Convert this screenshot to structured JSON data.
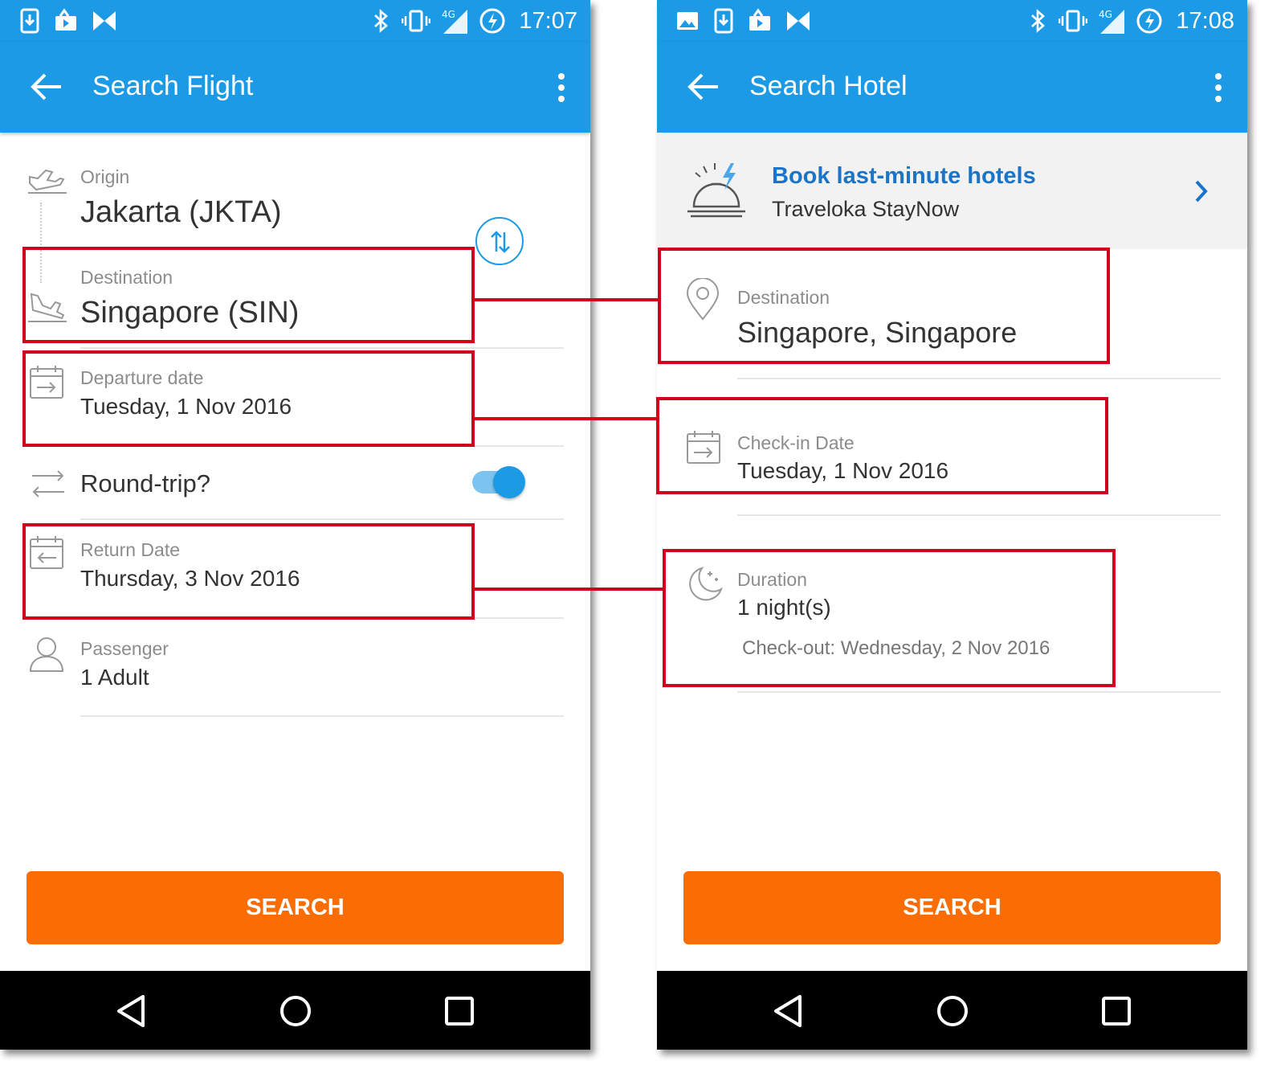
{
  "left_screen": {
    "status": {
      "time": "17:07",
      "network": "4G"
    },
    "appbar": {
      "title": "Search Flight"
    },
    "origin": {
      "label": "Origin",
      "value": "Jakarta (JKTA)"
    },
    "destination": {
      "label": "Destination",
      "value": "Singapore (SIN)"
    },
    "departure": {
      "label": "Departure date",
      "value": "Tuesday, 1 Nov 2016"
    },
    "roundtrip": {
      "label": "Round-trip?",
      "enabled": true
    },
    "return_date": {
      "label": "Return Date",
      "value": "Thursday, 3 Nov 2016"
    },
    "passenger": {
      "label": "Passenger",
      "value": "1 Adult"
    },
    "search_label": "SEARCH"
  },
  "right_screen": {
    "status": {
      "time": "17:08",
      "network": "4G"
    },
    "appbar": {
      "title": "Search Hotel"
    },
    "promo": {
      "title": "Book last-minute hotels",
      "subtitle": "Traveloka StayNow"
    },
    "destination": {
      "label": "Destination",
      "value": "Singapore, Singapore"
    },
    "checkin": {
      "label": "Check-in Date",
      "value": "Tuesday, 1 Nov 2016"
    },
    "duration": {
      "label": "Duration",
      "value": "1 night(s)",
      "checkout": "Check-out: Wednesday, 2 Nov 2016"
    },
    "search_label": "SEARCH"
  },
  "colors": {
    "appbar": "#1c9ae6",
    "search_button": "#f96d04",
    "highlight": "#d0021b",
    "promo_link": "#1a75c9"
  }
}
